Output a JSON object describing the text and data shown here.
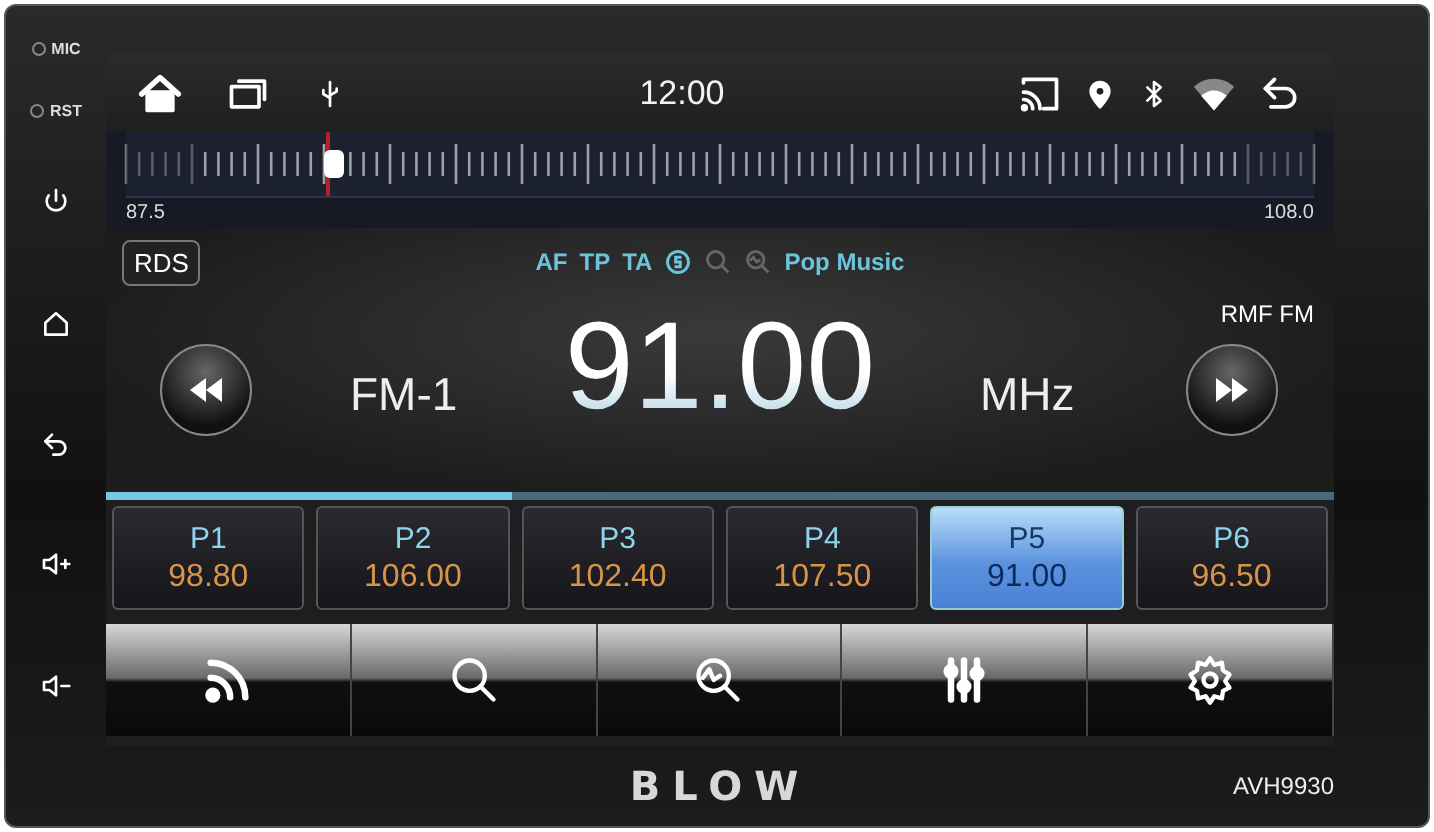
{
  "side_panel": {
    "labels": [
      "MIC",
      "RST"
    ]
  },
  "status_bar": {
    "time": "12:00"
  },
  "tuner": {
    "min_label": "87.5",
    "max_label": "108.0",
    "level": 0.17
  },
  "rds": {
    "button": "RDS",
    "flags": [
      {
        "label": "AF",
        "on": true
      },
      {
        "label": "TP",
        "on": true
      },
      {
        "label": "TA",
        "on": true
      }
    ],
    "program_type": "Pop Music"
  },
  "station": {
    "band": "FM-1",
    "frequency": "91.00",
    "unit": "MHz",
    "name": "RMF FM"
  },
  "page_indicator": {
    "level": 0.33
  },
  "presets": [
    {
      "label": "P1",
      "frequency": "98.80",
      "selected": false
    },
    {
      "label": "P2",
      "frequency": "106.00",
      "selected": false
    },
    {
      "label": "P3",
      "frequency": "102.40",
      "selected": false
    },
    {
      "label": "P4",
      "frequency": "107.50",
      "selected": false
    },
    {
      "label": "P5",
      "frequency": "91.00",
      "selected": true
    },
    {
      "label": "P6",
      "frequency": "96.50",
      "selected": false
    }
  ],
  "brand": {
    "logo": "BLOW",
    "model": "AVH9930"
  }
}
